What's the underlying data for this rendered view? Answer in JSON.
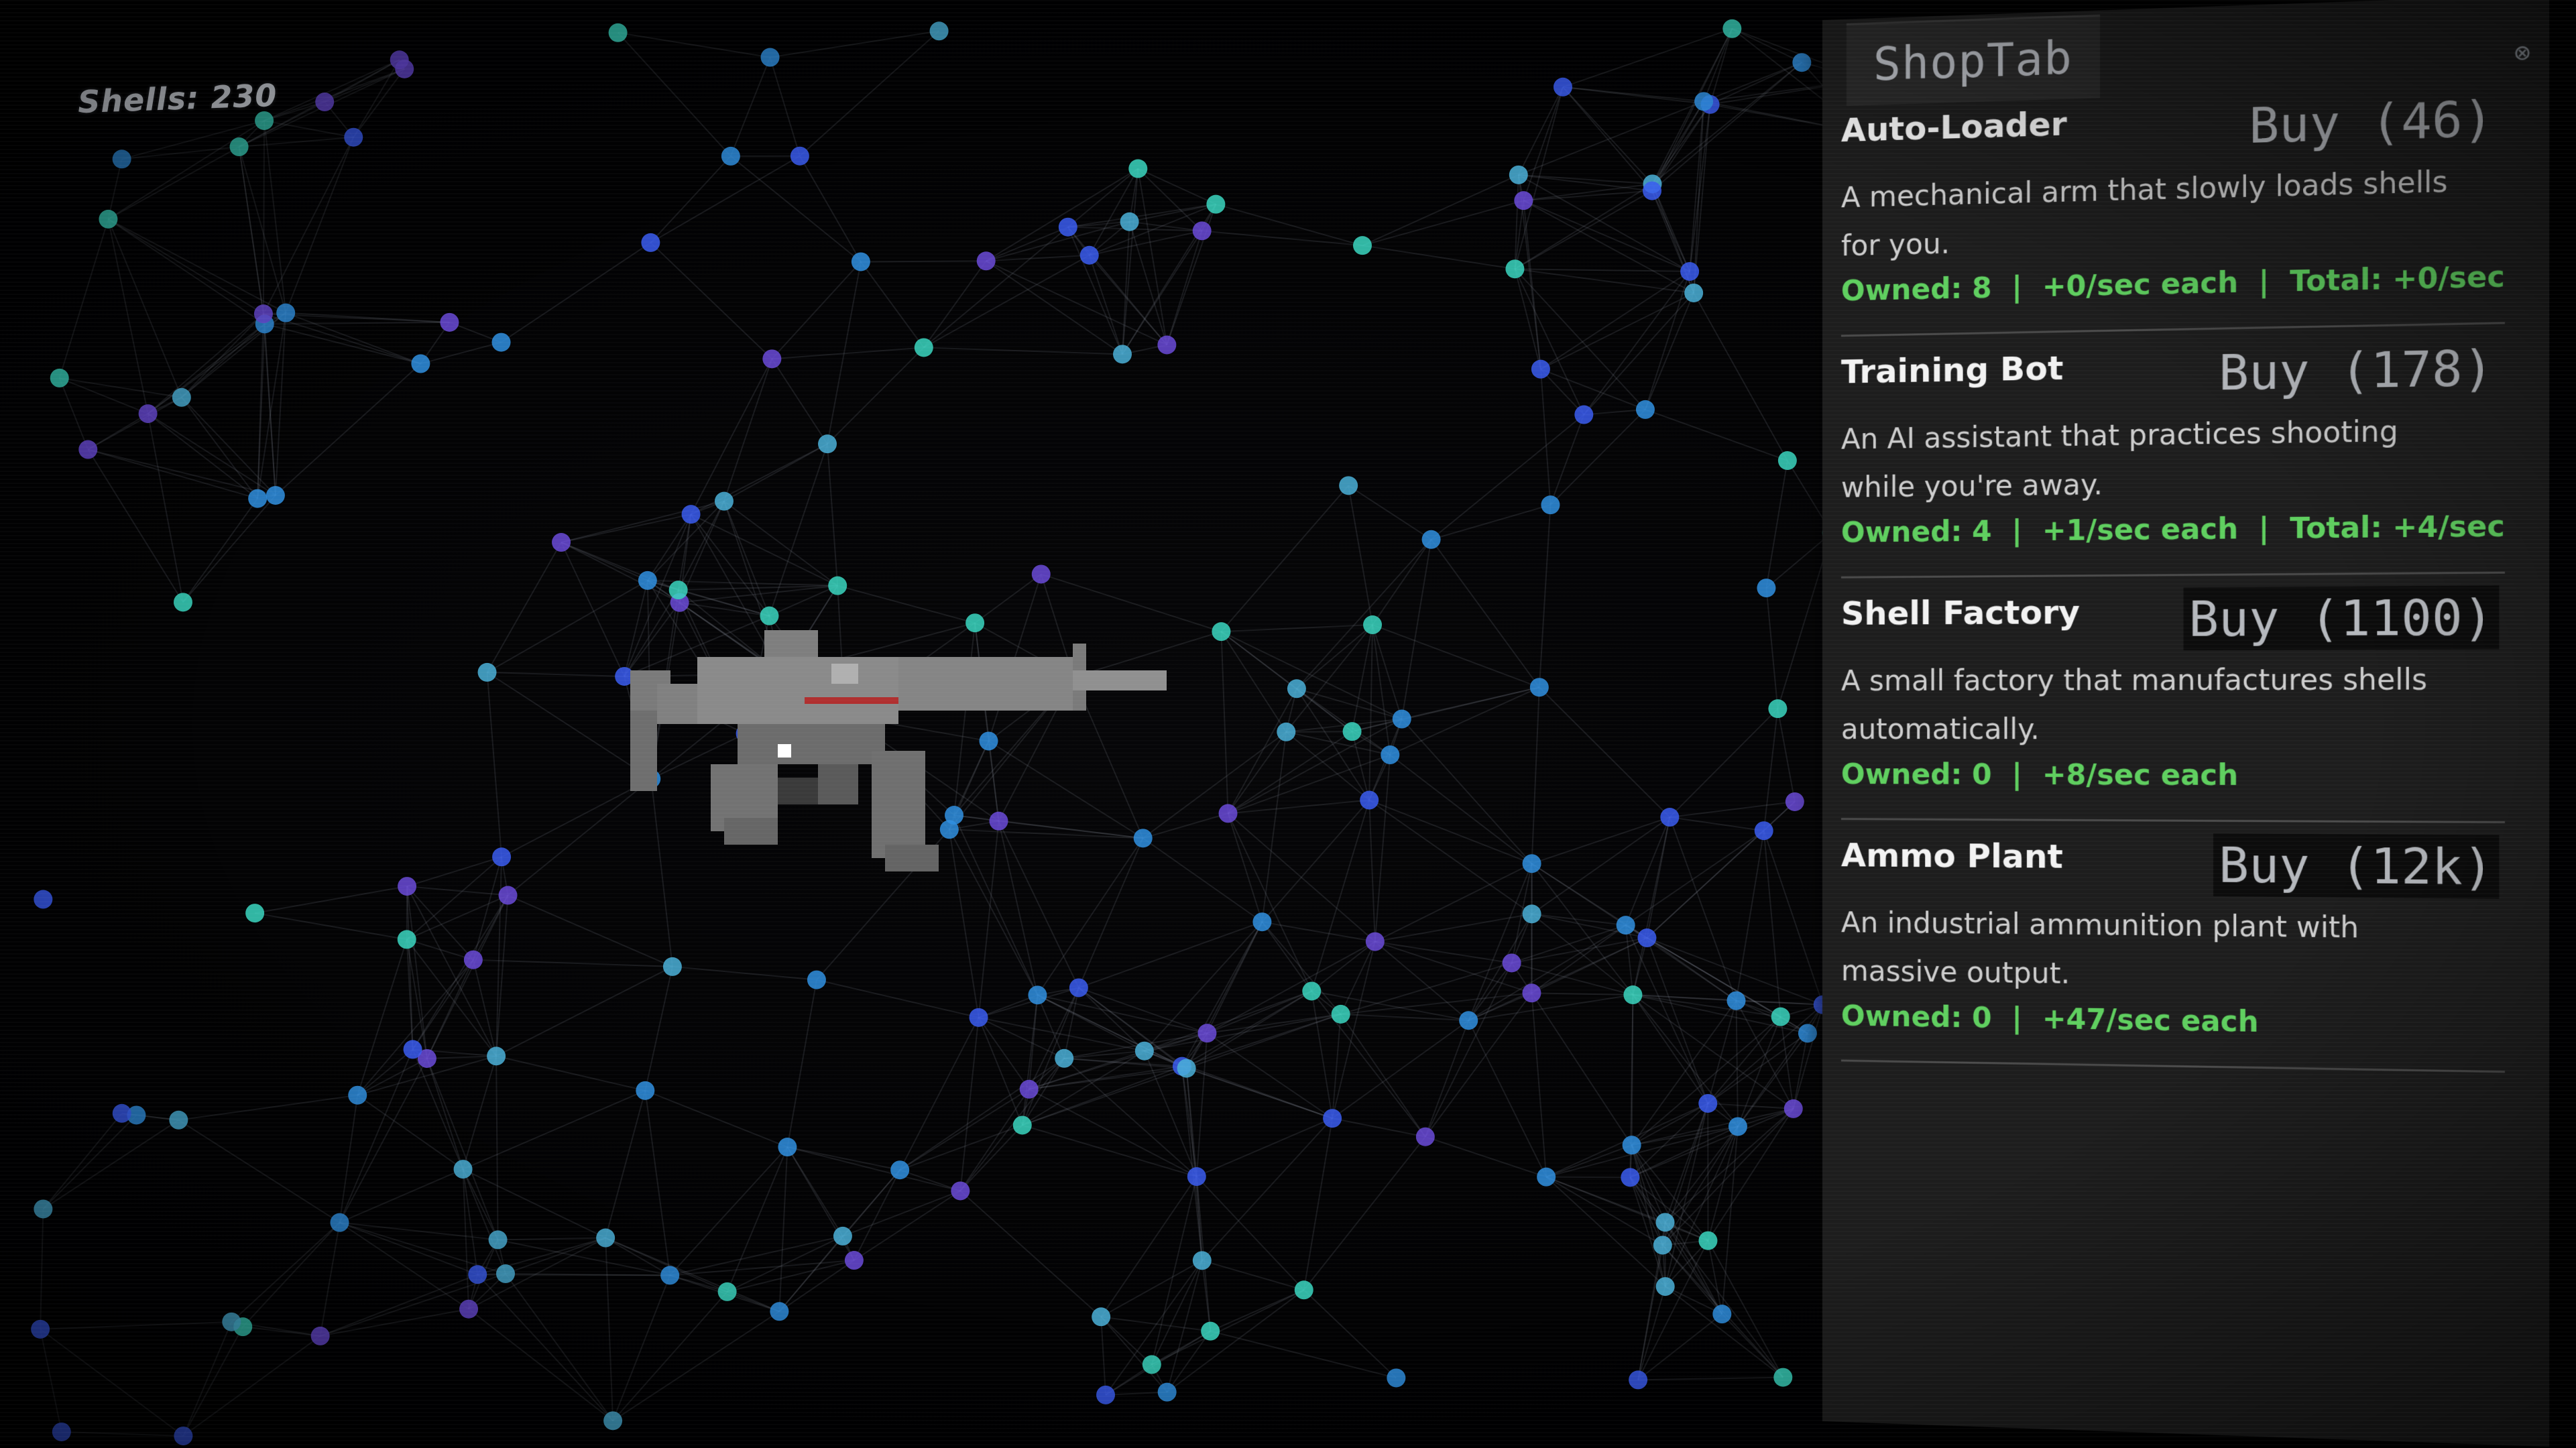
{
  "hud": {
    "shells_label": "Shells: 230"
  },
  "shop": {
    "tab_label": "ShopTab",
    "close_icon": "close-icon",
    "items": [
      {
        "name": "Auto-Loader",
        "buy_label": "Buy (46)",
        "description": "A mechanical arm that slowly loads shells for you.",
        "stats": "Owned: 8  |  +0/sec each  |  Total: +0/sec"
      },
      {
        "name": "Training Bot",
        "buy_label": "Buy (178)",
        "description": "An AI assistant that practices shooting while you're away.",
        "stats": "Owned: 4  |  +1/sec each  |  Total: +4/sec"
      },
      {
        "name": "Shell Factory",
        "buy_label": "Buy (1100)",
        "description": "A small factory that manufactures shells automatically.",
        "stats": "Owned: 0  |  +8/sec each"
      },
      {
        "name": "Ammo Plant",
        "buy_label": "Buy (12k)",
        "description": "An industrial ammunition plant with massive output.",
        "stats": "Owned: 0  |  +47/sec each"
      }
    ]
  },
  "colors": {
    "background": "#000000",
    "panel": "#1d1d1d",
    "stats_green": "#5fcf5f",
    "node_teal": "#3ad6c0",
    "node_blue": "#3a5cf0",
    "node_violet": "#6a4ad8"
  },
  "weapon": {
    "icon": "smg-icon"
  }
}
